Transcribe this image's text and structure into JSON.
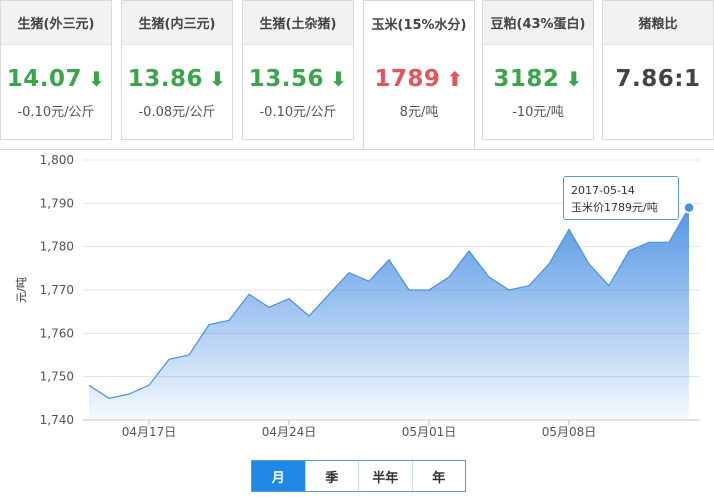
{
  "cards": [
    {
      "title": "生猪(外三元)",
      "value": "14.07",
      "trend": "down",
      "change": "-0.10元/公斤"
    },
    {
      "title": "生猪(内三元)",
      "value": "13.86",
      "trend": "down",
      "change": "-0.08元/公斤"
    },
    {
      "title": "生猪(土杂猪)",
      "value": "13.56",
      "trend": "down",
      "change": "-0.10元/公斤"
    },
    {
      "title": "玉米(15%水分)",
      "value": "1789",
      "trend": "up",
      "change": "8元/吨"
    },
    {
      "title": "豆粕(43%蛋白)",
      "value": "3182",
      "trend": "down",
      "change": "-10元/吨"
    },
    {
      "title": "猪粮比",
      "value": "7.86:1",
      "trend": "none",
      "change": ""
    }
  ],
  "icons": {
    "down": "arrow-down-icon",
    "up": "arrow-up-icon"
  },
  "colors": {
    "down": "#3aa54b",
    "up": "#e4555a",
    "series": "#4a90e2",
    "tab_selected": "#1f88e5"
  },
  "chart_data": {
    "type": "area",
    "ylabel": "元/吨",
    "ylim": [
      1740,
      1800
    ],
    "yticks": [
      "1,740",
      "1,750",
      "1,760",
      "1,770",
      "1,780",
      "1,790",
      "1,800"
    ],
    "xtick_labels": [
      "04月17日",
      "04月24日",
      "05月01日",
      "05月08日"
    ],
    "x": [
      "2017-04-14",
      "2017-04-15",
      "2017-04-16",
      "2017-04-17",
      "2017-04-18",
      "2017-04-19",
      "2017-04-20",
      "2017-04-21",
      "2017-04-22",
      "2017-04-23",
      "2017-04-24",
      "2017-04-25",
      "2017-04-26",
      "2017-04-27",
      "2017-04-28",
      "2017-04-29",
      "2017-04-30",
      "2017-05-01",
      "2017-05-02",
      "2017-05-03",
      "2017-05-04",
      "2017-05-05",
      "2017-05-06",
      "2017-05-07",
      "2017-05-08",
      "2017-05-09",
      "2017-05-10",
      "2017-05-11",
      "2017-05-12",
      "2017-05-13",
      "2017-05-14"
    ],
    "values": [
      1748,
      1745,
      1746,
      1748,
      1754,
      1755,
      1762,
      1763,
      1769,
      1766,
      1768,
      1764,
      1769,
      1774,
      1772,
      1777,
      1770,
      1770,
      1773,
      1779,
      1773,
      1770,
      1771,
      1776,
      1784,
      1776,
      1771,
      1779,
      1781,
      1781,
      1789
    ],
    "tooltip": {
      "date": "2017-05-14",
      "label": "玉米价1789元/吨"
    }
  },
  "tabs": [
    {
      "label": "月",
      "selected": true
    },
    {
      "label": "季",
      "selected": false
    },
    {
      "label": "半年",
      "selected": false
    },
    {
      "label": "年",
      "selected": false
    }
  ]
}
